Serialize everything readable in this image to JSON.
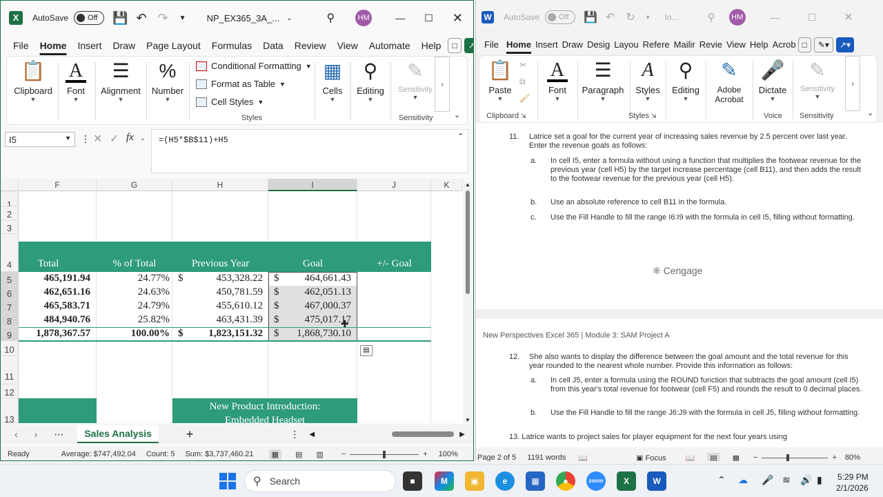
{
  "excel": {
    "autosave_label": "AutoSave",
    "autosave_state": "Off",
    "filename": "NP_EX365_3A_...",
    "avatar": "HM",
    "tabs": [
      "File",
      "Home",
      "Insert",
      "Draw",
      "Page Layout",
      "Formulas",
      "Data",
      "Review",
      "View",
      "Automate",
      "Help"
    ],
    "active_tab": "Home",
    "ribbon": {
      "clipboard": "Clipboard",
      "font": "Font",
      "alignment": "Alignment",
      "number": "Number",
      "conditional_formatting": "Conditional Formatting",
      "format_as_table": "Format as Table",
      "cell_styles": "Cell Styles",
      "styles_group": "Styles",
      "cells": "Cells",
      "editing": "Editing",
      "sensitivity": "Sensitivity",
      "sensitivity_group": "Sensitivity"
    },
    "name_box": "I5",
    "formula": "=(H5*$B$11)+H5",
    "columns": [
      "F",
      "G",
      "H",
      "I",
      "J",
      "K"
    ],
    "rows": [
      "1",
      "2",
      "3",
      "4",
      "5",
      "6",
      "7",
      "8",
      "9",
      "10",
      "11",
      "12",
      "13"
    ],
    "headers": {
      "total": "Total",
      "pct": "% of Total",
      "prev": "Previous Year",
      "goal": "Goal",
      "pm_goal": "+/- Goal"
    },
    "data_rows": [
      {
        "total": "465,191.94",
        "pct": "24.77%",
        "cur": "$",
        "prev": "453,328.22",
        "goal": "464,661.43"
      },
      {
        "total": "462,651.16",
        "pct": "24.63%",
        "cur": "",
        "prev": "450,781.59",
        "goal": "462,051.13"
      },
      {
        "total": "465,583.71",
        "pct": "24.79%",
        "cur": "",
        "prev": "455,610.12",
        "goal": "467,000.37"
      },
      {
        "total": "484,940.76",
        "pct": "25.82%",
        "cur": "",
        "prev": "463,431.39",
        "goal": "475,017.17"
      },
      {
        "total": "1,878,367.57",
        "pct": "100.00%",
        "cur": "$",
        "prev": "1,823,151.32",
        "goal": "1,868,730.10"
      }
    ],
    "dollar": "$",
    "new_product_line1": "New Product Introduction:",
    "new_product_line2": "Embedded Headset",
    "sheet_tab": "Sales Analysis",
    "status": {
      "ready": "Ready",
      "average": "Average: $747,492.04",
      "count": "Count: 5",
      "sum": "Sum: $3,737,460.21",
      "zoom": "100%"
    }
  },
  "word": {
    "autosave_label": "AutoSave",
    "autosave_state": "Off",
    "title": "In...",
    "avatar": "HM",
    "tabs": [
      "File",
      "Home",
      "Insert",
      "Draw",
      "Desig",
      "Layou",
      "Refere",
      "Mailir",
      "Revie",
      "View",
      "Help",
      "Acrob"
    ],
    "active_tab": "Home",
    "ribbon": {
      "paste": "Paste",
      "clipboard": "Clipboard",
      "font": "Font",
      "paragraph": "Paragraph",
      "styles": "Styles",
      "styles_group": "Styles",
      "editing": "Editing",
      "adobe": "Adobe Acrobat",
      "dictate": "Dictate",
      "voice": "Voice",
      "sensitivity": "Sensitivity",
      "sensitivity_group": "Sensitivity"
    },
    "page": {
      "item11_num": "11.",
      "item11": "Latrice set a goal for the current year of increasing sales revenue by 2.5 percent over last year. Enter the revenue goals as follows:",
      "a11": "In cell I5, enter a formula without using a function that multiplies the footwear revenue for the previous year (cell H5) by the target increase percentage (cell B11), and then adds the result to the footwear revenue for the previous year (cell H5).",
      "b11": "Use an absolute reference to cell B11 in the formula.",
      "c11": "Use the Fill Handle to fill the range I6:I9 with the formula in cell I5, filling without formatting.",
      "cengage": "Cengage",
      "header": "New Perspectives Excel 365 | Module 3: SAM Project A",
      "item12_num": "12.",
      "item12": "She also wants to display the difference between the goal amount and the total revenue for this year rounded to the nearest whole number. Provide this information as follows:",
      "a12": "In cell J5, enter a formula using the ROUND function that subtracts the goal amount (cell I5) from this year's total revenue for footwear (cell F5) and rounds the result to 0 decimal places.",
      "b12": "Use the Fill Handle to fill the range J6:J9 with the formula in cell J5, filling without formatting.",
      "item13": "13.   Latrice wants to project sales for player equipment for the next four years using"
    },
    "status": {
      "page": "Page 2 of 5",
      "words": "1191 words",
      "focus": "Focus",
      "zoom": "80%"
    }
  },
  "taskbar": {
    "search": "Search",
    "time": "5:29 PM",
    "date": "2/1/2026"
  },
  "colors": {
    "excel_green": "#1e7145",
    "teal": "#2e9b7b",
    "word_blue": "#185abd"
  }
}
